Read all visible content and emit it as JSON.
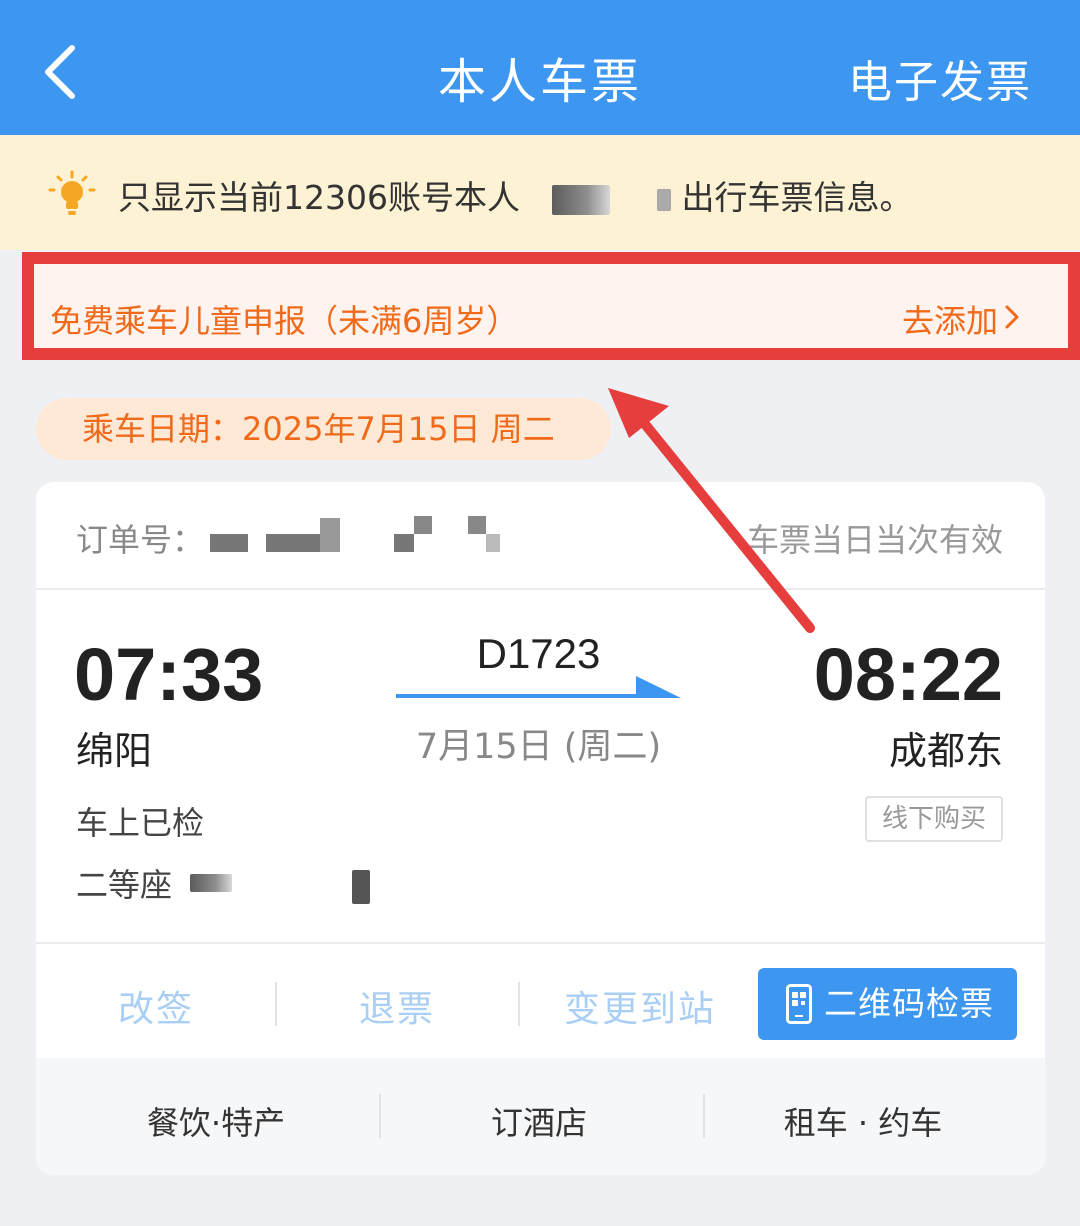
{
  "nav": {
    "title": "本人车票",
    "right_action": "电子发票",
    "back_icon": "chevron-left-icon"
  },
  "notice": {
    "icon": "lightbulb-icon",
    "text_before": "只显示当前12306账号本人",
    "text_after": "出行车票信息。"
  },
  "child_banner": {
    "label": "免费乘车儿童申报（未满6周岁）",
    "action": "去添加",
    "border_color": "#e63d3d",
    "text_color": "#f06a1a"
  },
  "travel_date": {
    "text": "乘车日期：2025年7月15日 周二"
  },
  "ticket": {
    "order_label": "订单号：",
    "validity": "车票当日当次有效",
    "departure_time": "07:33",
    "departure_station": "绵阳",
    "arrival_time": "08:22",
    "arrival_station": "成都东",
    "train_number": "D1723",
    "train_date": "7月15日 (周二)",
    "status": "车上已检",
    "seat_class": "二等座",
    "purchase_channel": "线下购买"
  },
  "actions": {
    "change": "改签",
    "refund": "退票",
    "change_destination": "变更到站",
    "qr_check": "二维码检票",
    "qr_icon": "qr-phone-icon",
    "primary_color": "#3d97f0"
  },
  "services": {
    "food": "餐饮·特产",
    "hotel": "订酒店",
    "car": "租车 · 约车"
  }
}
